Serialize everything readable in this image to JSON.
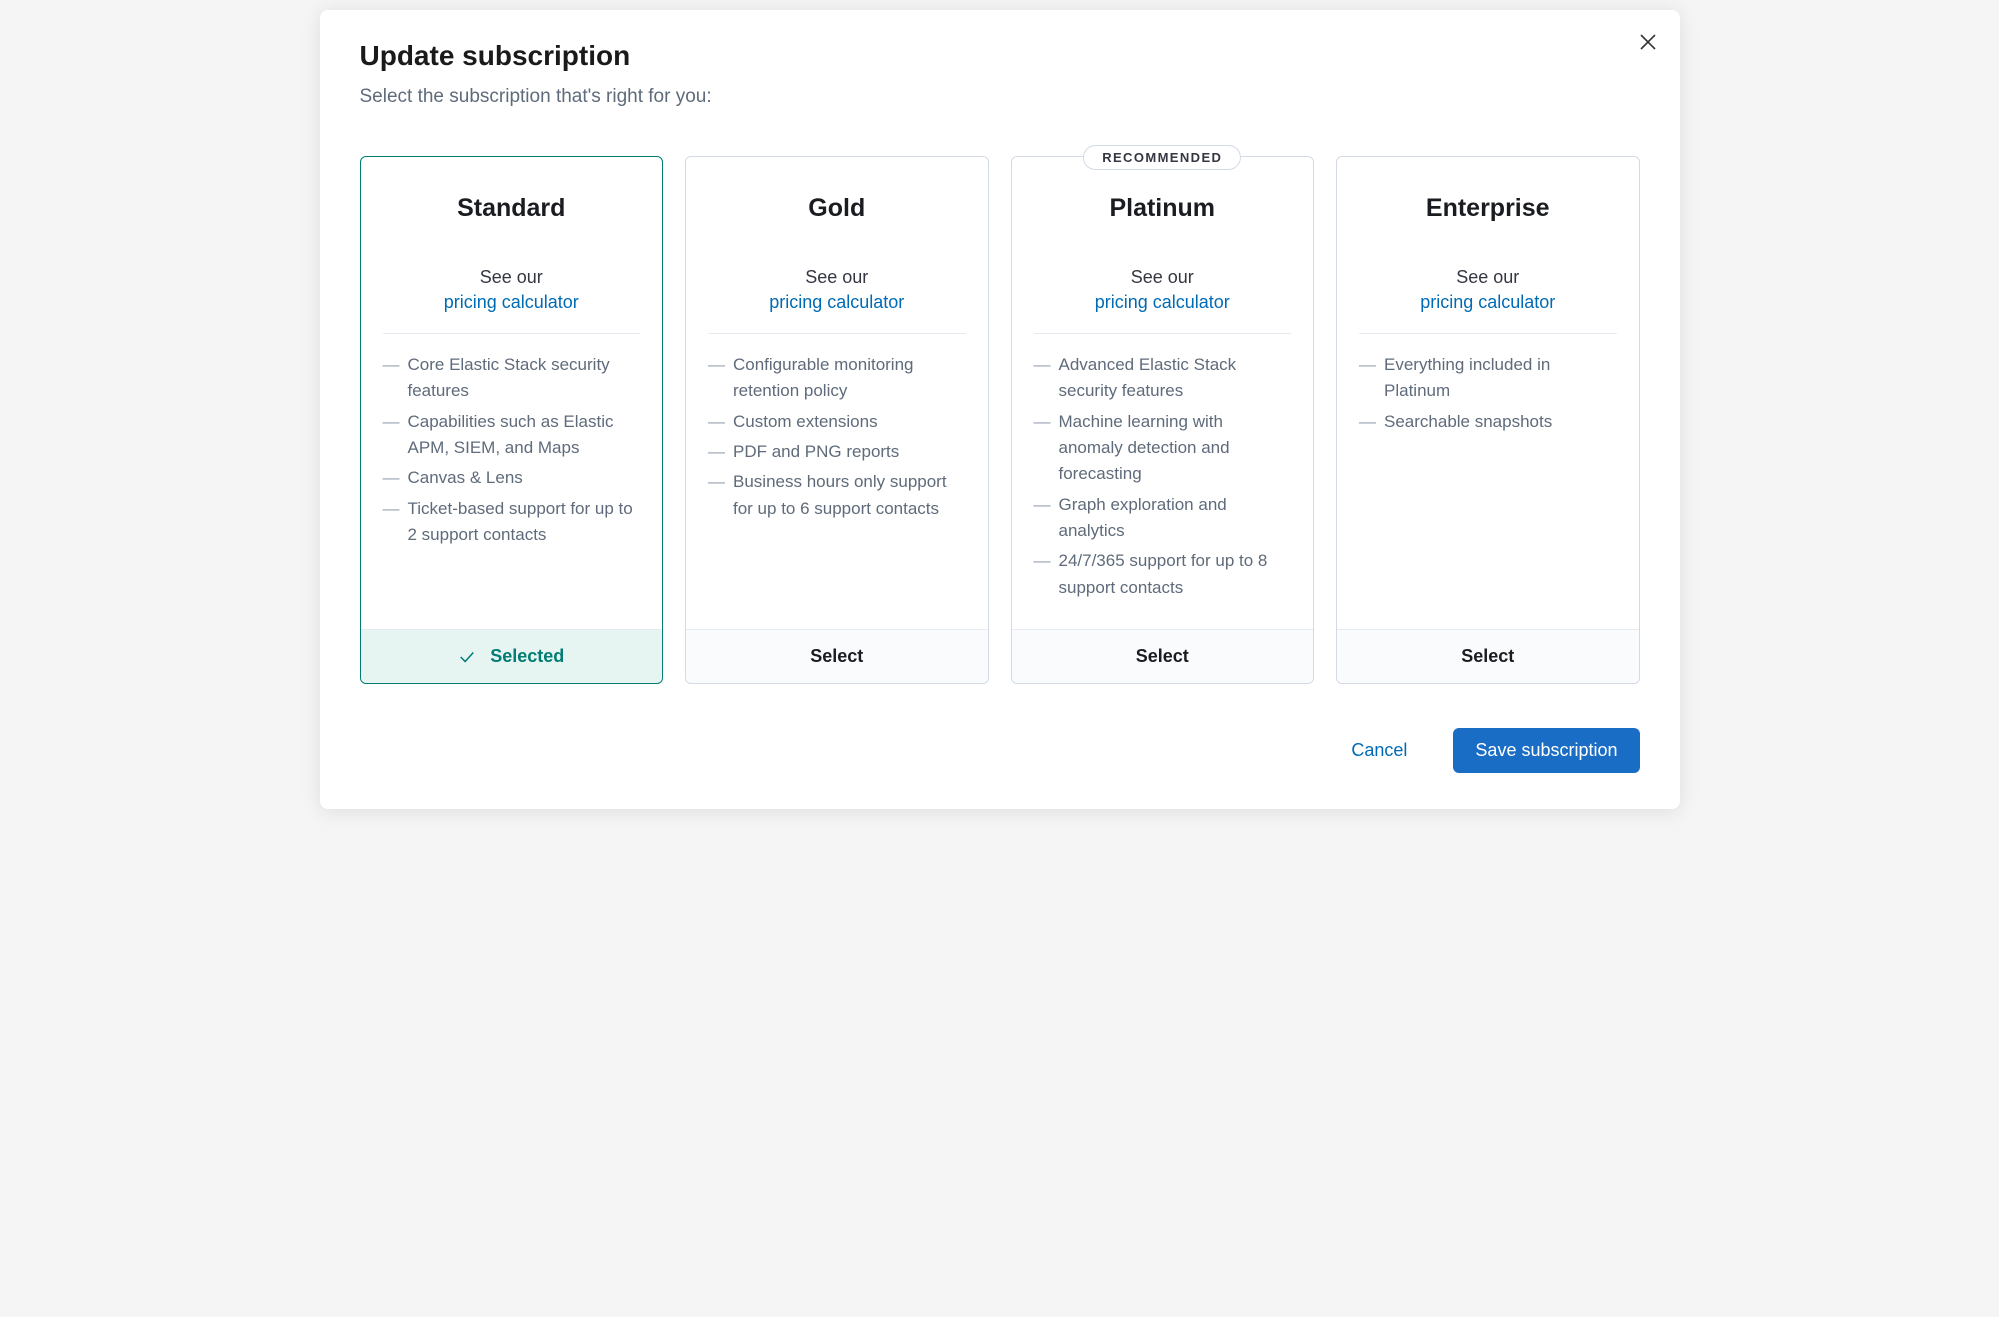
{
  "colors": {
    "link": "#006bb4",
    "primary": "#1a6dc4",
    "selected": "#017d73"
  },
  "modal": {
    "title": "Update subscription",
    "subtitle": "Select the subscription that's right for you:"
  },
  "common": {
    "see_our": "See our",
    "pricing_label": "pricing calculator",
    "select_label": "Select",
    "selected_label": "Selected",
    "recommended_label": "RECOMMENDED"
  },
  "plans": [
    {
      "name": "Standard",
      "selected": true,
      "recommended": false,
      "features": [
        "Core Elastic Stack security features",
        "Capabilities such as Elastic APM, SIEM, and Maps",
        "Canvas & Lens",
        "Ticket-based support for up to 2 support contacts"
      ]
    },
    {
      "name": "Gold",
      "selected": false,
      "recommended": false,
      "features": [
        "Configurable monitoring retention policy",
        "Custom extensions",
        "PDF and PNG reports",
        "Business hours only support for up to 6 support contacts"
      ]
    },
    {
      "name": "Platinum",
      "selected": false,
      "recommended": true,
      "features": [
        "Advanced Elastic Stack security features",
        "Machine learning with anomaly detection and forecasting",
        "Graph exploration and analytics",
        "24/7/365 support for up to 8 support contacts"
      ]
    },
    {
      "name": "Enterprise",
      "selected": false,
      "recommended": false,
      "features": [
        "Everything included in Platinum",
        "Searchable snapshots"
      ]
    }
  ],
  "actions": {
    "cancel": "Cancel",
    "save": "Save subscription"
  }
}
